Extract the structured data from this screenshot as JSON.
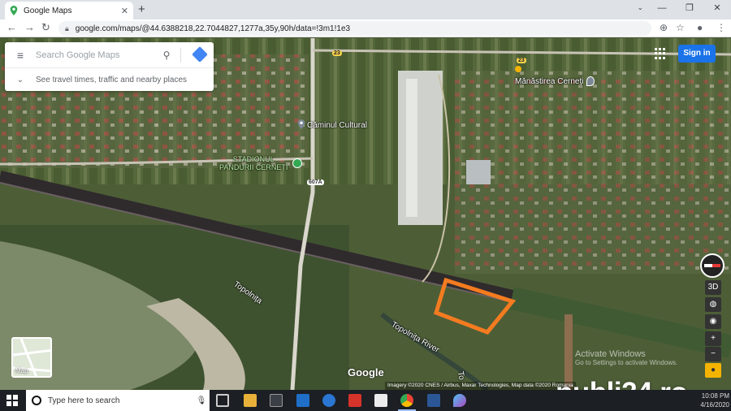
{
  "browser": {
    "tab_title": "Google Maps",
    "tab_close": "✕",
    "new_tab": "+",
    "url": "google.com/maps/@44.6388218,22.7044827,1277a,35y,90h/data=!3m1!1e3",
    "window_controls": [
      "—",
      "❐",
      "✕"
    ],
    "tab_dropdown": "⌄",
    "nav": {
      "back": "←",
      "forward": "→",
      "reload": "↻"
    }
  },
  "map": {
    "search_placeholder": "Search Google Maps",
    "travel_hint": "See travel times, traffic and nearby places",
    "sign_in": "Sign in",
    "places": {
      "caminul": "Căminul Cultural",
      "stadion_line1": "STADIONUL",
      "stadion_line2": "PANDURII CERNEȚI",
      "manastirea": "Mănăstirea Cerneți",
      "topolnita": "Topolnița",
      "topolnita_river": "Topolnița River",
      "topolnita_short": "To"
    },
    "road_badges": {
      "r23_top": "23",
      "r23_mid": "23",
      "r607a": "607A"
    },
    "layer_label": "Map",
    "controls": {
      "three_d": "3D",
      "zoom_in": "+",
      "zoom_out": "−"
    },
    "logo": "Google",
    "attribution": "Imagery ©2020 CNES / Airbus, Maxar Technologies, Map data ©2020    Romania",
    "activate_title": "Activate Windows",
    "activate_sub": "Go to Settings to activate Windows.",
    "marked_area_color": "#f47b20"
  },
  "watermark": "publi24.ro",
  "taskbar": {
    "search_text": "Type here to search",
    "clock_time": "10:08 PM",
    "clock_date": "4/16/2020"
  }
}
